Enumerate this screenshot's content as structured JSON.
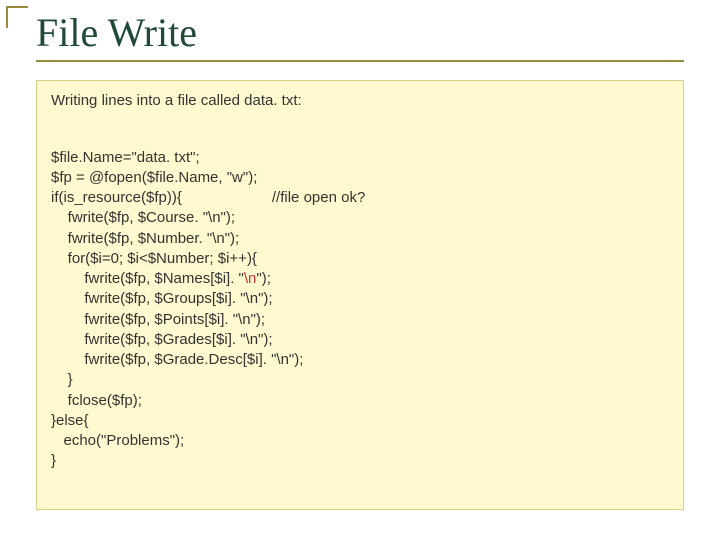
{
  "title": "File Write",
  "intro": "Writing lines into a file called data. txt:",
  "code": {
    "l1": "$file.Name=\"data. txt\";",
    "l2": "$fp = @fopen($file.Name, \"w\");",
    "l3a": "if(is_resource($fp)){",
    "l3b": "//file open ok?",
    "l4": "    fwrite($fp, $Course. \"\\n\");",
    "l5": "    fwrite($fp, $Number. \"\\n\");",
    "l6": "    for($i=0; $i<$Number; $i++){",
    "l7a": "        fwrite($fp, $Names[$i]. \"",
    "l7b": "\\n",
    "l7c": "\");",
    "l8": "        fwrite($fp, $Groups[$i]. \"\\n\");",
    "l9": "        fwrite($fp, $Points[$i]. \"\\n\");",
    "l10": "        fwrite($fp, $Grades[$i]. \"\\n\");",
    "l11": "        fwrite($fp, $Grade.Desc[$i]. \"\\n\");",
    "l12": "    }",
    "l13": "    fclose($fp);",
    "l14": "}else{",
    "l15": "   echo(\"Problems\");",
    "l16": "}"
  }
}
